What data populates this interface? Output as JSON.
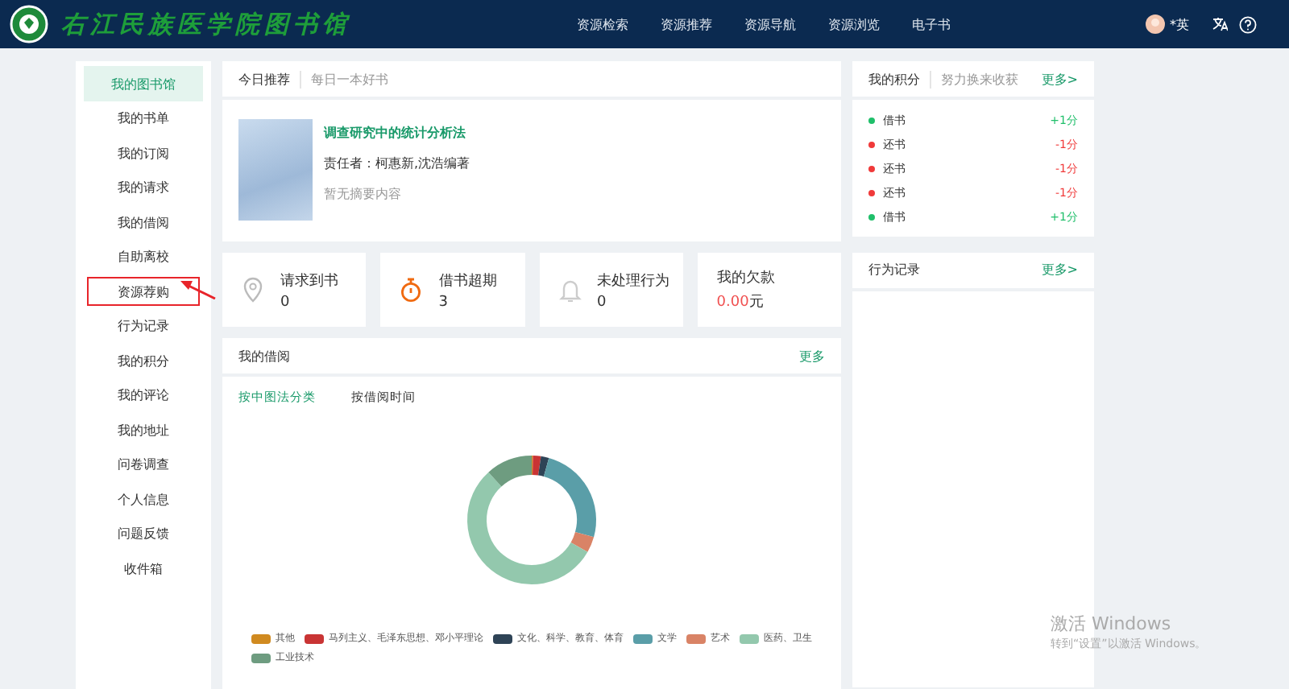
{
  "header": {
    "library_name": "右江民族医学院图书馆",
    "nav": [
      {
        "label": "资源检索"
      },
      {
        "label": "资源推荐"
      },
      {
        "label": "资源导航"
      },
      {
        "label": "资源浏览"
      },
      {
        "label": "电子书"
      }
    ],
    "user_name": "*英"
  },
  "sidebar": {
    "items": [
      {
        "label": "我的图书馆",
        "selected": true,
        "highlighted": false
      },
      {
        "label": "我的书单",
        "selected": false,
        "highlighted": false
      },
      {
        "label": "我的订阅",
        "selected": false,
        "highlighted": false
      },
      {
        "label": "我的请求",
        "selected": false,
        "highlighted": false
      },
      {
        "label": "我的借阅",
        "selected": false,
        "highlighted": false
      },
      {
        "label": "自助离校",
        "selected": false,
        "highlighted": false
      },
      {
        "label": "资源荐购",
        "selected": false,
        "highlighted": true
      },
      {
        "label": "行为记录",
        "selected": false,
        "highlighted": false
      },
      {
        "label": "我的积分",
        "selected": false,
        "highlighted": false
      },
      {
        "label": "我的评论",
        "selected": false,
        "highlighted": false
      },
      {
        "label": "我的地址",
        "selected": false,
        "highlighted": false
      },
      {
        "label": "问卷调查",
        "selected": false,
        "highlighted": false
      },
      {
        "label": "个人信息",
        "selected": false,
        "highlighted": false
      },
      {
        "label": "问题反馈",
        "selected": false,
        "highlighted": false
      },
      {
        "label": "收件箱",
        "selected": false,
        "highlighted": false
      }
    ]
  },
  "recommend": {
    "title": "今日推荐",
    "subtitle": "每日一本好书",
    "book_title": "调查研究中的统计分析法",
    "author": "责任者：柯惠新,沈浩编著",
    "summary": "暂无摘要内容"
  },
  "stats": [
    {
      "kind": "pin",
      "label": "请求到书",
      "value": "0"
    },
    {
      "kind": "timer",
      "label": "借书超期",
      "value": "3"
    },
    {
      "kind": "bell",
      "label": "未处理行为",
      "value": "0"
    },
    {
      "kind": "money",
      "label": "我的欠款",
      "value": "0.00",
      "unit": "元"
    }
  ],
  "borrow": {
    "title": "我的借阅",
    "more": "更多",
    "tabs": [
      {
        "label": "按中图法分类",
        "selected": true
      },
      {
        "label": "按借阅时间",
        "selected": false
      }
    ],
    "legend": [
      {
        "label": "其他",
        "color": "#d08a20"
      },
      {
        "label": "马列主义、毛泽东思想、邓小平理论",
        "color": "#c93434"
      },
      {
        "label": "文化、科学、教育、体育",
        "color": "#2e4356"
      },
      {
        "label": "文学",
        "color": "#5a9ea8"
      },
      {
        "label": "艺术",
        "color": "#d98366"
      },
      {
        "label": "医药、卫生",
        "color": "#93c8ad"
      },
      {
        "label": "工业技术",
        "color": "#6e9c80"
      }
    ]
  },
  "points": {
    "title": "我的积分",
    "subtitle": "努力换来收获",
    "more": "更多>",
    "items": [
      {
        "label": "借书",
        "score": "+1分",
        "color": "#1fbf6a"
      },
      {
        "label": "还书",
        "score": "-1分",
        "color": "#f03a3a"
      },
      {
        "label": "还书",
        "score": "-1分",
        "color": "#f03a3a"
      },
      {
        "label": "还书",
        "score": "-1分",
        "color": "#f03a3a"
      },
      {
        "label": "借书",
        "score": "+1分",
        "color": "#1fbf6a"
      }
    ]
  },
  "behavior": {
    "title": "行为记录",
    "more": "更多>"
  },
  "os_overlay": {
    "title": "激活 Windows",
    "text": "转到“设置”以激活 Windows。"
  }
}
